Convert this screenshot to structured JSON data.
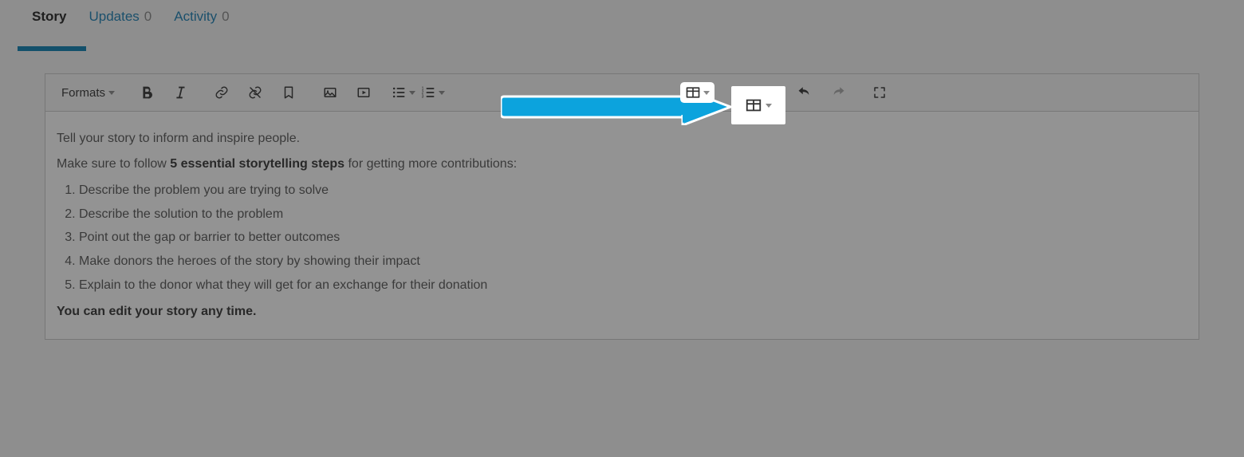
{
  "tabs": {
    "story": {
      "label": "Story",
      "active": true
    },
    "updates": {
      "label": "Updates",
      "count": "0"
    },
    "activity": {
      "label": "Activity",
      "count": "0"
    }
  },
  "toolbar": {
    "formats_label": "Formats"
  },
  "content": {
    "p1": "Tell your story to inform and inspire people.",
    "p2a": "Make sure to follow ",
    "p2b": "5 essential storytelling steps",
    "p2c": " for getting more contributions:",
    "steps": {
      "s1": "Describe the problem you are trying to solve",
      "s2": "Describe the solution to the problem",
      "s3": "Point out the gap or barrier to better outcomes",
      "s4": "Make donors the heroes of the story by showing their impact",
      "s5": "Explain to the donor what they will get for an exchange for their donation"
    },
    "p3": "You can edit your story any time."
  },
  "annotation": {
    "arrow_color": "#0ca3dd"
  }
}
